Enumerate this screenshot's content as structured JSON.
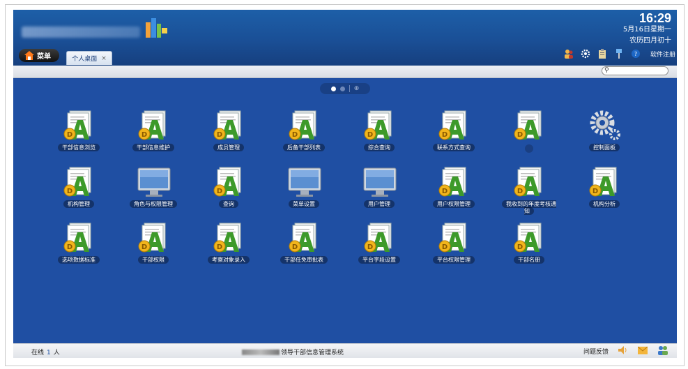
{
  "header": {
    "clock": {
      "time": "16:29",
      "date": "5月16日星期一",
      "lunar": "农历四月初十"
    },
    "menu_label": "菜单",
    "tabs": [
      {
        "label": "个人桌面",
        "close": "×"
      }
    ],
    "toolbar": {
      "register_label": "软件注册"
    }
  },
  "desktop": {
    "apps": [
      {
        "label": "干部信息浏览",
        "icon": "document-a-icon"
      },
      {
        "label": "干部信息维护",
        "icon": "document-a-icon"
      },
      {
        "label": "成员管理",
        "icon": "document-a-icon"
      },
      {
        "label": "后备干部列表",
        "icon": "document-a-icon"
      },
      {
        "label": "综合查询",
        "icon": "document-a-icon"
      },
      {
        "label": "联系方式查询",
        "icon": "document-a-icon"
      },
      {
        "label": "",
        "icon": "document-a-icon"
      },
      {
        "label": "控制面板",
        "icon": "gear-icon"
      },
      {
        "label": "机构管理",
        "icon": "document-a-icon"
      },
      {
        "label": "角色与权限管理",
        "icon": "monitor-icon"
      },
      {
        "label": "查询",
        "icon": "document-a-icon"
      },
      {
        "label": "菜单设置",
        "icon": "monitor-icon"
      },
      {
        "label": "用户管理",
        "icon": "monitor-icon"
      },
      {
        "label": "用户权限管理",
        "icon": "document-a-icon"
      },
      {
        "label": "我收到的年度考核通知",
        "icon": "document-a-icon"
      },
      {
        "label": "机构分析",
        "icon": "document-a-icon"
      },
      {
        "label": "选项数据标准",
        "icon": "document-a-icon"
      },
      {
        "label": "干部权限",
        "icon": "document-a-icon"
      },
      {
        "label": "考察对象录入",
        "icon": "document-a-icon"
      },
      {
        "label": "干部任免审批表",
        "icon": "document-a-icon"
      },
      {
        "label": "平台字段设置",
        "icon": "document-a-icon"
      },
      {
        "label": "平台权限管理",
        "icon": "document-a-icon"
      },
      {
        "label": "干部名册",
        "icon": "document-a-icon"
      }
    ]
  },
  "footer": {
    "online_prefix": "在线",
    "online_count": "1",
    "online_suffix": "人",
    "system_name": "领导干部信息管理系统",
    "feedback_label": "问题反馈"
  },
  "colors": {
    "desktop_bg": "#1f4fa3",
    "header_bg": "#1a4f96",
    "accent": "#ff9900"
  }
}
